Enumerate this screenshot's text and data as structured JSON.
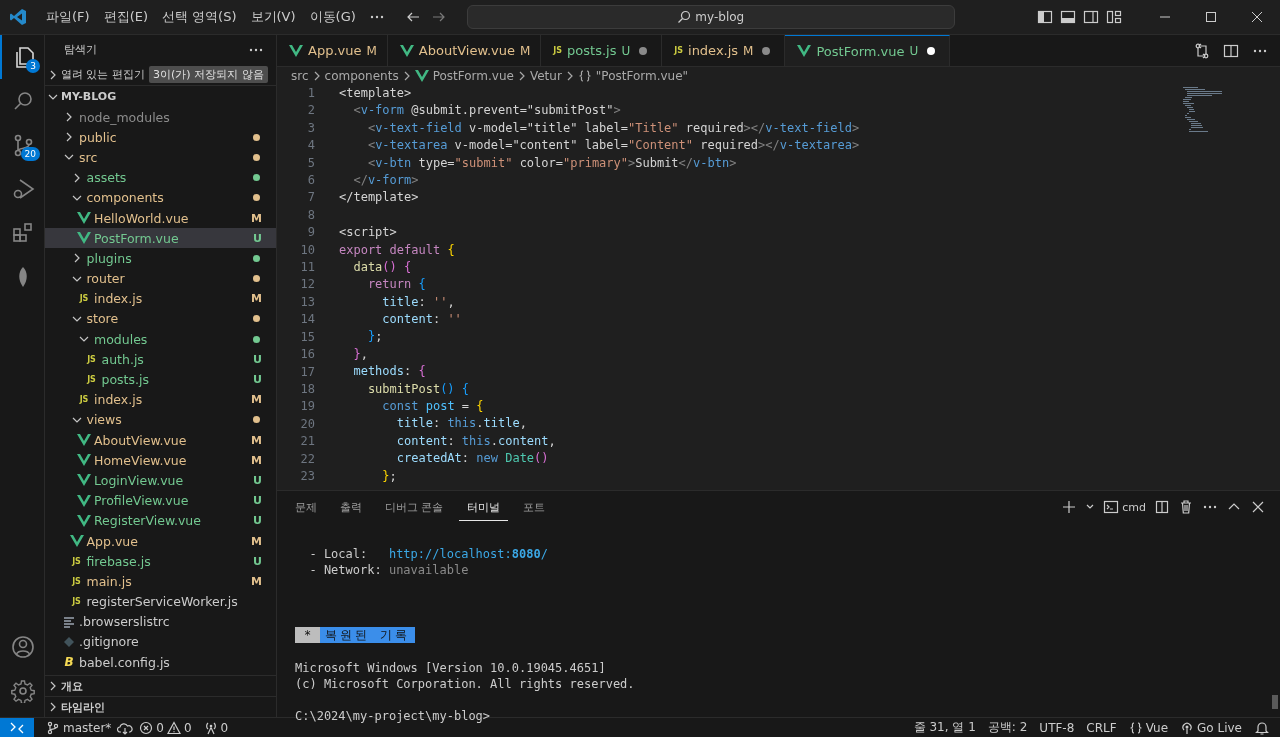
{
  "title_bar": {
    "menu": [
      "파일(F)",
      "편집(E)",
      "선택 영역(S)",
      "보기(V)",
      "이동(G)"
    ],
    "search": "my-blog"
  },
  "activity_bar": [
    {
      "kind": "explorer",
      "selected": true,
      "badge": "3"
    },
    {
      "kind": "search",
      "selected": false
    },
    {
      "kind": "source-control",
      "selected": false,
      "badge": "20"
    },
    {
      "kind": "run-debug",
      "selected": false
    },
    {
      "kind": "extensions",
      "selected": false
    },
    {
      "kind": "leaf",
      "selected": false
    }
  ],
  "activity_bar_bottom": [
    {
      "kind": "account"
    },
    {
      "kind": "settings"
    }
  ],
  "sidebar": {
    "title": "탐색기",
    "open_editors": {
      "label": "열려 있는 편집기",
      "note": "3이(가) 저장되지 않음",
      "expanded": false
    },
    "project": {
      "label": "MY-BLOG",
      "expanded": true
    },
    "tree": [
      {
        "name": "node_modules",
        "kind": "folder",
        "expanded": false,
        "selected": false,
        "color": "#8c8c8c"
      },
      {
        "name": "public",
        "kind": "folder",
        "expanded": false,
        "selected": false,
        "color": "#e2c08d",
        "dot": true
      },
      {
        "name": "src",
        "kind": "folder",
        "expanded": true,
        "selected": false,
        "color": "#e2c08d",
        "dot": true,
        "children": [
          {
            "name": "assets",
            "kind": "folder",
            "expanded": false,
            "selected": false,
            "color": "#73c991",
            "dot": true
          },
          {
            "name": "components",
            "kind": "folder",
            "expanded": true,
            "selected": false,
            "color": "#e2c08d",
            "dot": true,
            "children": [
              {
                "name": "HelloWorld.vue",
                "kind": "vue",
                "selected": false,
                "color": "#e2c08d",
                "status": "M"
              },
              {
                "name": "PostForm.vue",
                "kind": "vue",
                "selected": true,
                "color": "#73c991",
                "status": "U"
              }
            ]
          },
          {
            "name": "plugins",
            "kind": "folder",
            "expanded": false,
            "selected": false,
            "color": "#73c991",
            "dot": true
          },
          {
            "name": "router",
            "kind": "folder",
            "expanded": true,
            "selected": false,
            "color": "#e2c08d",
            "dot": true,
            "children": [
              {
                "name": "index.js",
                "kind": "js",
                "icon_label": "JS",
                "selected": false,
                "color": "#e2c08d",
                "status": "M"
              }
            ]
          },
          {
            "name": "store",
            "kind": "folder",
            "expanded": true,
            "selected": false,
            "color": "#e2c08d",
            "dot": true,
            "children": [
              {
                "name": "modules",
                "kind": "folder",
                "expanded": true,
                "selected": false,
                "color": "#73c991",
                "dot": true,
                "children": [
                  {
                    "name": "auth.js",
                    "kind": "js",
                    "icon_label": "JS",
                    "selected": false,
                    "color": "#73c991",
                    "status": "U"
                  },
                  {
                    "name": "posts.js",
                    "kind": "js",
                    "icon_label": "JS",
                    "selected": false,
                    "color": "#73c991",
                    "status": "U"
                  }
                ]
              },
              {
                "name": "index.js",
                "kind": "js",
                "icon_label": "JS",
                "selected": false,
                "color": "#e2c08d",
                "status": "M"
              }
            ]
          },
          {
            "name": "views",
            "kind": "folder",
            "expanded": true,
            "selected": false,
            "color": "#e2c08d",
            "dot": true,
            "children": [
              {
                "name": "AboutView.vue",
                "kind": "vue",
                "selected": false,
                "color": "#e2c08d",
                "status": "M"
              },
              {
                "name": "HomeView.vue",
                "kind": "vue",
                "selected": false,
                "color": "#e2c08d",
                "status": "M"
              },
              {
                "name": "LoginView.vue",
                "kind": "vue",
                "selected": false,
                "color": "#73c991",
                "status": "U"
              },
              {
                "name": "ProfileView.vue",
                "kind": "vue",
                "selected": false,
                "color": "#73c991",
                "status": "U"
              },
              {
                "name": "RegisterView.vue",
                "kind": "vue",
                "selected": false,
                "color": "#73c991",
                "status": "U"
              }
            ]
          },
          {
            "name": "App.vue",
            "kind": "vue",
            "selected": false,
            "color": "#e2c08d",
            "status": "M"
          },
          {
            "name": "firebase.js",
            "kind": "js",
            "icon_label": "JS",
            "selected": false,
            "color": "#73c991",
            "status": "U"
          },
          {
            "name": "main.js",
            "kind": "js",
            "icon_label": "JS",
            "selected": false,
            "color": "#e2c08d",
            "status": "M"
          },
          {
            "name": "registerServiceWorker.js",
            "kind": "js",
            "icon_label": "JS",
            "selected": false,
            "color": "#cccccc"
          }
        ]
      },
      {
        "name": ".browserslistrc",
        "kind": "text",
        "selected": false,
        "color": "#cccccc"
      },
      {
        "name": ".gitignore",
        "kind": "git",
        "selected": false,
        "color": "#cccccc"
      },
      {
        "name": "babel.config.js",
        "kind": "babel",
        "icon_label": "B",
        "selected": false,
        "color": "#cccccc"
      }
    ],
    "sections": [
      {
        "label": "개요",
        "expanded": false
      },
      {
        "label": "타임라인",
        "expanded": false
      }
    ]
  },
  "tabs": [
    {
      "label": "App.vue",
      "kind": "vue",
      "status": "M",
      "color": "#e2c08d",
      "dirty": false,
      "selected": false
    },
    {
      "label": "AboutView.vue",
      "kind": "vue",
      "status": "M",
      "color": "#e2c08d",
      "dirty": false,
      "selected": false
    },
    {
      "label": "posts.js",
      "kind": "js",
      "icon_label": "JS",
      "status": "U",
      "color": "#73c991",
      "dirty": true,
      "selected": false
    },
    {
      "label": "index.js",
      "kind": "js",
      "icon_label": "JS",
      "status": "M",
      "color": "#e2c08d",
      "dirty": true,
      "selected": false
    },
    {
      "label": "PostForm.vue",
      "kind": "vue",
      "status": "U",
      "color": "#73c991",
      "dirty": true,
      "selected": true
    }
  ],
  "breadcrumbs": [
    {
      "kind": "text",
      "text": "src"
    },
    {
      "kind": "text",
      "text": "components"
    },
    {
      "kind": "vue",
      "text": "PostForm.vue"
    },
    {
      "kind": "text",
      "text": "Vetur"
    },
    {
      "kind": "symbol",
      "text": "\"PostForm.vue\""
    }
  ],
  "code": [
    {
      "num": "1",
      "tokens": [
        {
          "kind": "txt",
          "text": "<template>"
        }
      ],
      "children": [
        {
          "num": "2",
          "tokens": [
            {
              "kind": "p",
              "text": "<"
            },
            {
              "kind": "tag",
              "text": "v-form"
            },
            {
              "kind": "txt",
              "text": " @submit.prevent=\"submitPost\""
            },
            {
              "kind": "p",
              "text": ">"
            }
          ],
          "children": [
            {
              "num": "3",
              "tokens": [
                {
                  "kind": "p",
                  "text": "<"
                },
                {
                  "kind": "tag",
                  "text": "v-text-field"
                },
                {
                  "kind": "txt",
                  "text": " v-model=\"title\" label="
                },
                {
                  "kind": "str",
                  "text": "\"Title\""
                },
                {
                  "kind": "txt",
                  "text": " required"
                },
                {
                  "kind": "p",
                  "text": "></"
                },
                {
                  "kind": "tag",
                  "text": "v-text-field"
                },
                {
                  "kind": "p",
                  "text": ">"
                }
              ]
            },
            {
              "num": "4",
              "tokens": [
                {
                  "kind": "p",
                  "text": "<"
                },
                {
                  "kind": "tag",
                  "text": "v-textarea"
                },
                {
                  "kind": "txt",
                  "text": " v-model=\"content\" label="
                },
                {
                  "kind": "str",
                  "text": "\"Content\""
                },
                {
                  "kind": "txt",
                  "text": " required"
                },
                {
                  "kind": "p",
                  "text": "></"
                },
                {
                  "kind": "tag",
                  "text": "v-textarea"
                },
                {
                  "kind": "p",
                  "text": ">"
                }
              ]
            },
            {
              "num": "5",
              "tokens": [
                {
                  "kind": "p",
                  "text": "<"
                },
                {
                  "kind": "tag",
                  "text": "v-btn"
                },
                {
                  "kind": "txt",
                  "text": " type="
                },
                {
                  "kind": "str",
                  "text": "\"submit\""
                },
                {
                  "kind": "txt",
                  "text": " color="
                },
                {
                  "kind": "str",
                  "text": "\"primary\""
                },
                {
                  "kind": "p",
                  "text": ">"
                },
                {
                  "kind": "txt",
                  "text": "Submit"
                },
                {
                  "kind": "p",
                  "text": "</"
                },
                {
                  "kind": "tag",
                  "text": "v-btn"
                },
                {
                  "kind": "p",
                  "text": ">"
                }
              ]
            }
          ]
        },
        {
          "num": "6",
          "tokens": [
            {
              "kind": "p",
              "text": "</"
            },
            {
              "kind": "tag",
              "text": "v-form"
            },
            {
              "kind": "p",
              "text": ">"
            }
          ]
        }
      ]
    },
    {
      "num": "7",
      "tokens": [
        {
          "kind": "txt",
          "text": "</template>"
        }
      ]
    },
    {
      "num": "8"
    },
    {
      "num": "9",
      "tokens": [
        {
          "kind": "txt",
          "text": "<script>"
        }
      ]
    },
    {
      "num": "10",
      "tokens": [
        {
          "kind": "kw",
          "text": "export default "
        },
        {
          "kind": "b1",
          "text": "{"
        }
      ],
      "children": [
        {
          "num": "11",
          "tokens": [
            {
              "kind": "fn",
              "text": "data"
            },
            {
              "kind": "b2",
              "text": "()"
            },
            {
              "kind": "b2",
              "text": " {"
            }
          ],
          "children": [
            {
              "num": "12",
              "tokens": [
                {
                  "kind": "kw",
                  "text": "return "
                },
                {
                  "kind": "b3",
                  "text": "{"
                }
              ],
              "children": [
                {
                  "num": "13",
                  "tokens": [
                    {
                      "kind": "prop",
                      "text": "title"
                    },
                    {
                      "kind": "txt",
                      "text": ": "
                    },
                    {
                      "kind": "str",
                      "text": "''"
                    },
                    {
                      "kind": "txt",
                      "text": ","
                    }
                  ]
                },
                {
                  "num": "14",
                  "tokens": [
                    {
                      "kind": "prop",
                      "text": "content"
                    },
                    {
                      "kind": "txt",
                      "text": ": "
                    },
                    {
                      "kind": "str",
                      "text": "''"
                    }
                  ]
                }
              ]
            },
            {
              "num": "15",
              "tokens": [
                {
                  "kind": "b3",
                  "text": "}"
                },
                {
                  "kind": "txt",
                  "text": ";"
                }
              ]
            }
          ]
        },
        {
          "num": "16",
          "tokens": [
            {
              "kind": "b2",
              "text": "}"
            },
            {
              "kind": "txt",
              "text": ","
            }
          ]
        },
        {
          "num": "17",
          "tokens": [
            {
              "kind": "prop",
              "text": "methods"
            },
            {
              "kind": "txt",
              "text": ": "
            },
            {
              "kind": "b2",
              "text": "{"
            }
          ],
          "children": [
            {
              "num": "18",
              "tokens": [
                {
                  "kind": "fn",
                  "text": "submitPost"
                },
                {
                  "kind": "b3",
                  "text": "()"
                },
                {
                  "kind": "b3",
                  "text": " {"
                }
              ],
              "children": [
                {
                  "num": "19",
                  "tokens": [
                    {
                      "kind": "stor",
                      "text": "const "
                    },
                    {
                      "kind": "cvar",
                      "text": "post"
                    },
                    {
                      "kind": "txt",
                      "text": " = "
                    },
                    {
                      "kind": "b1",
                      "text": "{"
                    }
                  ],
                  "children": [
                    {
                      "num": "20",
                      "tokens": [
                        {
                          "kind": "prop",
                          "text": "title"
                        },
                        {
                          "kind": "txt",
                          "text": ": "
                        },
                        {
                          "kind": "stor",
                          "text": "this"
                        },
                        {
                          "kind": "txt",
                          "text": "."
                        },
                        {
                          "kind": "prop",
                          "text": "title"
                        },
                        {
                          "kind": "txt",
                          "text": ","
                        }
                      ]
                    },
                    {
                      "num": "21",
                      "tokens": [
                        {
                          "kind": "prop",
                          "text": "content"
                        },
                        {
                          "kind": "txt",
                          "text": ": "
                        },
                        {
                          "kind": "stor",
                          "text": "this"
                        },
                        {
                          "kind": "txt",
                          "text": "."
                        },
                        {
                          "kind": "prop",
                          "text": "content"
                        },
                        {
                          "kind": "txt",
                          "text": ","
                        }
                      ]
                    },
                    {
                      "num": "22",
                      "tokens": [
                        {
                          "kind": "prop",
                          "text": "createdAt"
                        },
                        {
                          "kind": "txt",
                          "text": ": "
                        },
                        {
                          "kind": "stor",
                          "text": "new "
                        },
                        {
                          "kind": "cls",
                          "text": "Date"
                        },
                        {
                          "kind": "b2",
                          "text": "()"
                        }
                      ]
                    }
                  ]
                },
                {
                  "num": "23",
                  "tokens": [
                    {
                      "kind": "b1",
                      "text": "}"
                    },
                    {
                      "kind": "txt",
                      "text": ";"
                    }
                  ]
                }
              ]
            }
          ]
        }
      ]
    }
  ],
  "panel": {
    "tabs": [
      {
        "label": "문제",
        "selected": false
      },
      {
        "label": "출력",
        "selected": false
      },
      {
        "label": "디버그 콘솔",
        "selected": false
      },
      {
        "label": "터미널",
        "selected": true
      },
      {
        "label": "포트",
        "selected": false
      }
    ],
    "shell": "cmd",
    "terminal": [
      {
        "kind": "blank"
      },
      {
        "kind": "text",
        "segments": [
          {
            "kind": "plain",
            "text": "  - Local:   "
          },
          {
            "kind": "link",
            "text": "http://localhost:"
          },
          {
            "kind": "link-bold",
            "text": "8080"
          },
          {
            "kind": "link",
            "text": "/"
          }
        ]
      },
      {
        "kind": "text",
        "segments": [
          {
            "kind": "plain",
            "text": "  - Network: "
          },
          {
            "kind": "dim",
            "text": "unavailable"
          }
        ]
      },
      {
        "kind": "blank"
      },
      {
        "kind": "blank"
      },
      {
        "kind": "blank"
      },
      {
        "kind": "banner",
        "mark": "*",
        "text": "복원된 기록"
      },
      {
        "kind": "blank"
      },
      {
        "kind": "text",
        "segments": [
          {
            "kind": "plain",
            "text": "Microsoft Windows [Version 10.0.19045.4651]"
          }
        ]
      },
      {
        "kind": "text",
        "segments": [
          {
            "kind": "plain",
            "text": "(c) Microsoft Corporation. All rights reserved."
          }
        ]
      },
      {
        "kind": "blank"
      },
      {
        "kind": "text",
        "segments": [
          {
            "kind": "plain",
            "text": "C:\\2024\\my-project\\my-blog>"
          }
        ]
      }
    ]
  },
  "status_bar": {
    "branch": "master*",
    "errors": "0",
    "warnings": "0",
    "ports": "0",
    "right": [
      {
        "kind": "text",
        "text": "줄 31, 열 1"
      },
      {
        "kind": "text",
        "text": "공백: 2"
      },
      {
        "kind": "text",
        "text": "UTF-8"
      },
      {
        "kind": "text",
        "text": "CRLF"
      },
      {
        "kind": "language",
        "text": "Vue"
      },
      {
        "kind": "golive",
        "text": "Go Live"
      },
      {
        "kind": "bell"
      }
    ]
  }
}
